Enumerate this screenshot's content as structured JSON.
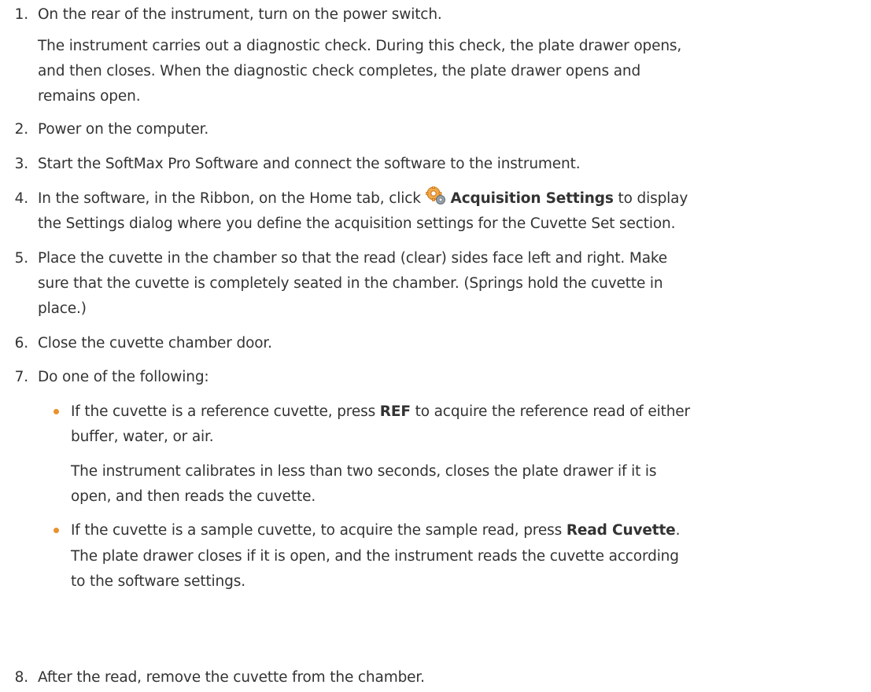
{
  "steps": [
    {
      "num": "1.",
      "text": "On the rear of the instrument, turn on the power switch.",
      "detail": [
        "The instrument carries out a diagnostic check. During this check, the plate drawer opens,",
        "and then closes. When the diagnostic check completes, the plate drawer opens and",
        "remains open."
      ]
    },
    {
      "num": "2.",
      "text": "Power on the computer."
    },
    {
      "num": "3.",
      "text": "Start the SoftMax Pro Software and connect the software to the instrument."
    },
    {
      "num": "4.",
      "pre": "In the software, in the Ribbon, on the Home tab, click",
      "bold": "Acquisition Settings",
      "post": "to display",
      "line2": "the Settings dialog where you define the acquisition settings for the Cuvette Set section.",
      "icon": "acquisition-settings-icon"
    },
    {
      "num": "5.",
      "lines": [
        "Place the cuvette in the chamber so that the read (clear) sides face left and right. Make",
        "sure that the cuvette is completely seated in the chamber. (Springs hold the cuvette in",
        "place.)"
      ]
    },
    {
      "num": "6.",
      "text": "Close the cuvette chamber door."
    },
    {
      "num": "7.",
      "text": "Do one of the following:",
      "options": [
        {
          "pre": "If the cuvette is a reference cuvette, press",
          "bold": "REF",
          "post": "to acquire the reference read of either",
          "line2": "buffer, water, or air.",
          "detail": [
            "The instrument calibrates in less than two seconds, closes the plate drawer if it is",
            "open, and then reads the cuvette."
          ]
        },
        {
          "pre": "If the cuvette is a sample cuvette, to acquire the sample read, press",
          "bold": "Read Cuvette",
          "post": ".",
          "detail": [
            "The plate drawer closes if it is open, and the instrument reads the cuvette according",
            "to the software settings."
          ]
        }
      ]
    },
    {
      "num": "8.",
      "text": "After the read, remove the cuvette from the chamber."
    }
  ],
  "colors": {
    "text": "#333333",
    "bullet": "#e8922e"
  }
}
